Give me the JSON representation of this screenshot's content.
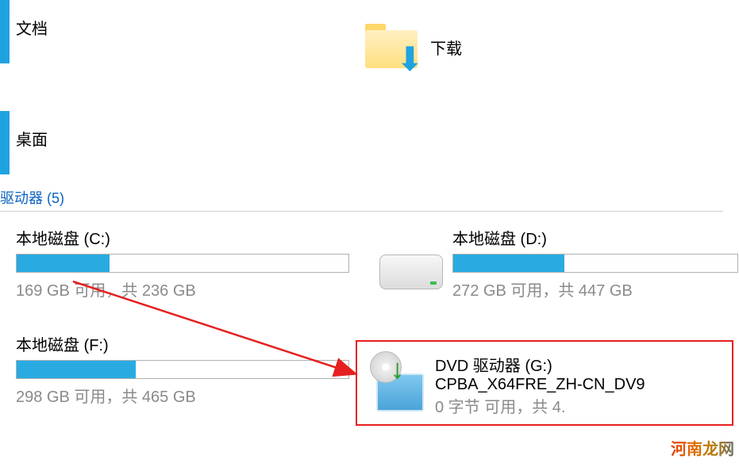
{
  "folders": {
    "documents": {
      "label": "文档"
    },
    "downloads": {
      "label": "下载"
    },
    "desktop": {
      "label": "桌面"
    }
  },
  "section_header": "驱动器 (5)",
  "drives": {
    "c": {
      "name": "本地磁盘 (C:)",
      "stats": "169 GB 可用，共 236 GB",
      "used_percent": 28
    },
    "d": {
      "name": "本地磁盘 (D:)",
      "stats": "272 GB 可用，共 447 GB",
      "used_percent": 39
    },
    "f": {
      "name": "本地磁盘 (F:)",
      "stats": "298 GB 可用，共 465 GB",
      "used_percent": 36
    },
    "g": {
      "line1": "DVD 驱动器 (G:)",
      "line2": "CPBA_X64FRE_ZH-CN_DV9",
      "line3": "0 字节 可用，共 4."
    }
  },
  "watermark": "河南龙网"
}
